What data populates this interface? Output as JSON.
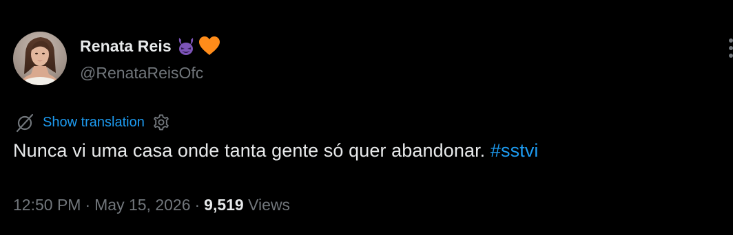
{
  "author": {
    "display_name": "Renata Reis",
    "handle": "@RenataReisOfc",
    "name_emojis": [
      "smiling-devil-icon",
      "orange-heart-icon"
    ]
  },
  "translation": {
    "label": "Show translation",
    "icon": "translate-icon",
    "settings_icon": "settings-gear-icon"
  },
  "tweet": {
    "text": "Nunca vi uma casa onde tanta gente só quer abandonar.",
    "hashtag": "#sstvi"
  },
  "meta": {
    "time": "12:50 PM",
    "separator": "·",
    "date": "May 15, 2026",
    "views_count": "9,519",
    "views_label": "Views"
  },
  "colors": {
    "background": "#000000",
    "primary_text": "#e7e9ea",
    "secondary_text": "#71767b",
    "link": "#1d9bf0",
    "devil_purple": "#7d54b8",
    "heart_orange": "#ff8c1a"
  }
}
